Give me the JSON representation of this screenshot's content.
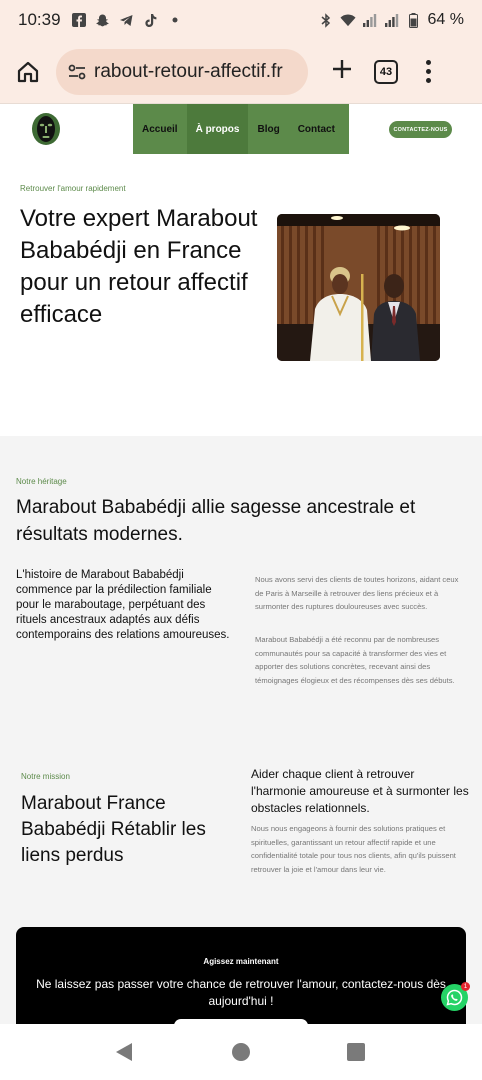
{
  "status_bar": {
    "time": "10:39",
    "battery": "64 %",
    "left_icons": [
      "facebook-icon",
      "snapchat-icon",
      "telegram-icon",
      "tiktok-icon",
      "dot-icon"
    ],
    "right_icons": [
      "bluetooth-icon",
      "wifi-icon",
      "signal-icon",
      "signal-icon-2",
      "battery-icon"
    ]
  },
  "browser": {
    "url": "rabout-retour-affectif.fr",
    "tab_count": "43"
  },
  "header": {
    "nav": [
      "Accueil",
      "À propos",
      "Blog",
      "Contact"
    ],
    "active_nav": "À propos",
    "contact_button": "CONTACTEZ-NOUS"
  },
  "hero": {
    "eyebrow": "Retrouver l'amour rapidement",
    "title": "Votre expert Marabout Bababédji en France pour un retour affectif efficace"
  },
  "heritage": {
    "eyebrow": "Notre héritage",
    "title": "Marabout Bababédji allie sagesse ancestrale et résultats modernes.",
    "lead": "L'histoire de Marabout Bababédji commence par la prédilection familiale pour le maraboutage, perpétuant des rituels ancestraux adaptés aux défis contemporains des relations amoureuses.",
    "p1": "Nous avons servi des clients de toutes horizons, aidant ceux de Paris à Marseille à retrouver des liens précieux et à surmonter des ruptures douloureuses avec succès.",
    "p2": "Marabout Bababédji a été reconnu par de nombreuses communautés pour sa capacité à transformer des vies et apporter des solutions concrètes, recevant ainsi des témoignages élogieux et des récompenses dès ses débuts."
  },
  "mission": {
    "eyebrow": "Notre mission",
    "title": "Marabout France Bababédji Rétablir les liens perdus",
    "lead": "Aider chaque client à retrouver l'harmonie amoureuse et à surmonter les obstacles relationnels.",
    "body": "Nous nous engageons à fournir des solutions pratiques et spirituelles, garantissant un retour affectif rapide et une confidentialité totale pour tous nos clients, afin qu'ils puissent retrouver la joie et l'amour dans leur vie."
  },
  "cta": {
    "eyebrow": "Agissez maintenant",
    "text": "Ne laissez pas passer votre chance de retrouver l'amour, contactez-nous dès aujourd'hui !"
  },
  "whatsapp": {
    "badge": "1"
  },
  "colors": {
    "accent": "#5c8a4a",
    "status_bg": "#fbece4",
    "url_pill": "#f4d9cb",
    "whatsapp": "#25d366"
  }
}
